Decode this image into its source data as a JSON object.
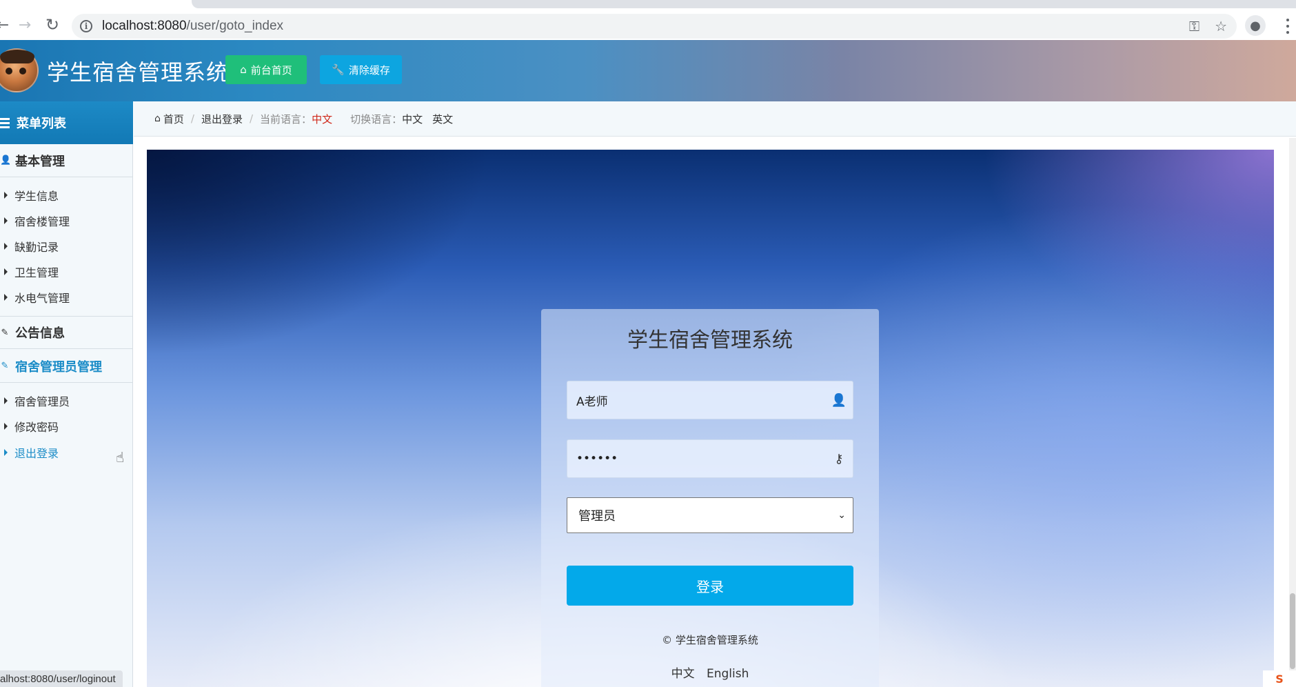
{
  "browser": {
    "url_host": "localhost:8080",
    "url_path": "/user/goto_index",
    "status_url": "alhost:8080/user/loginout"
  },
  "header": {
    "title": "学生宿舍管理系统",
    "home_button": "前台首页",
    "cache_button": "清除缓存",
    "brand_color": "#1a76b3"
  },
  "sidebar": {
    "heading": "菜单列表",
    "groups": [
      {
        "label": "基本管理",
        "items": [
          "学生信息",
          "宿舍楼管理",
          "缺勤记录",
          "卫生管理",
          "水电气管理"
        ]
      },
      {
        "label": "公告信息",
        "items": []
      },
      {
        "label": "宿舍管理员管理",
        "items": [
          "宿舍管理员",
          "修改密码",
          "退出登录"
        ]
      }
    ]
  },
  "breadcrumb": {
    "home": "首页",
    "logout": "退出登录",
    "current_lang_label": "当前语言：",
    "current_lang": "中文",
    "switch_lang_label": "切换语言：",
    "lang_zh": "中文",
    "lang_en": "英文"
  },
  "login": {
    "title": "学生宿舍管理系统",
    "username": "A老师",
    "password": "••••••",
    "role": "管理员",
    "submit": "登录",
    "copyright": "© 学生宿舍管理系统",
    "lang_zh": "中文",
    "lang_en": "English",
    "button_color": "#03a9ea"
  }
}
